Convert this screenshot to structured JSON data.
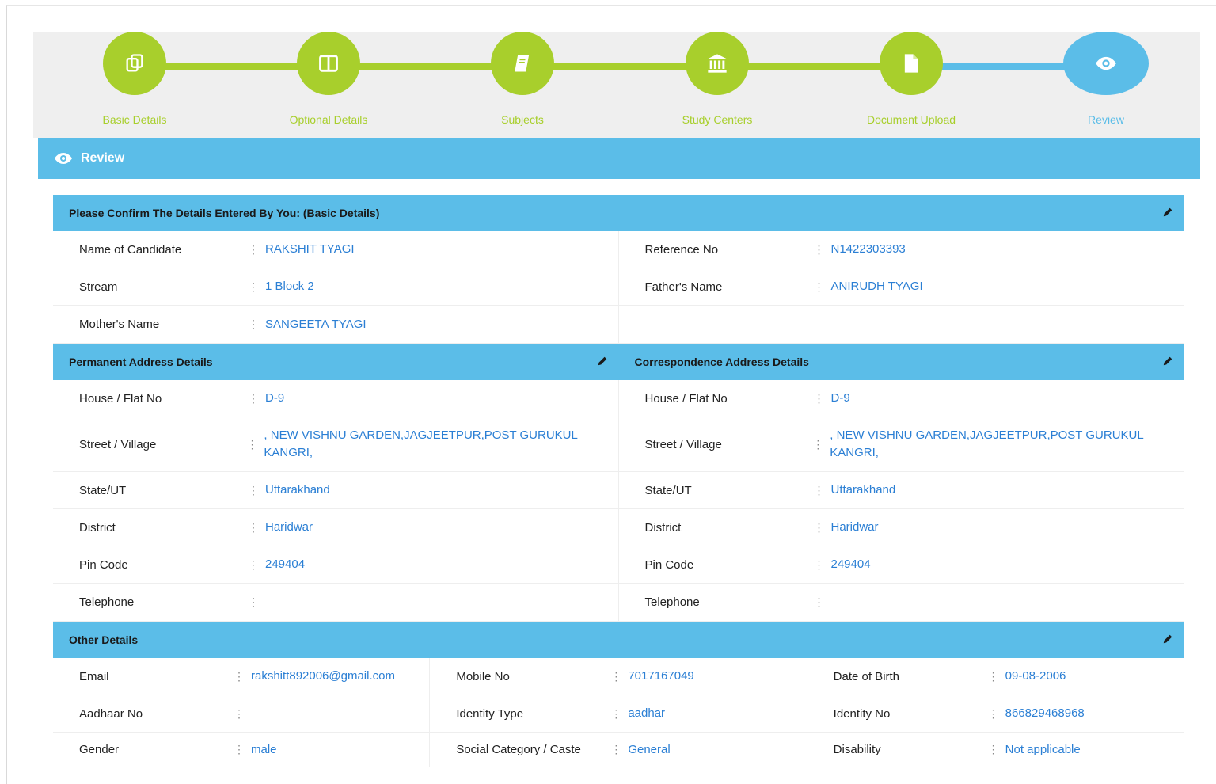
{
  "steps": [
    {
      "label": "Basic Details",
      "icon": "copy-icon"
    },
    {
      "label": "Optional Details",
      "icon": "columns-icon"
    },
    {
      "label": "Subjects",
      "icon": "book-icon"
    },
    {
      "label": "Study Centers",
      "icon": "bank-icon"
    },
    {
      "label": "Document Upload",
      "icon": "file-icon"
    },
    {
      "label": "Review",
      "icon": "eye-icon",
      "active": true
    }
  ],
  "review": {
    "title": "Review"
  },
  "basic": {
    "title": "Please Confirm The Details Entered By You: (Basic Details)",
    "name_label": "Name of Candidate",
    "name": "RAKSHIT TYAGI",
    "ref_label": "Reference No",
    "ref": "N1422303393",
    "stream_label": "Stream",
    "stream": "1 Block 2",
    "father_label": "Father's Name",
    "father": "ANIRUDH TYAGI",
    "mother_label": "Mother's Name",
    "mother": "SANGEETA TYAGI"
  },
  "permanent": {
    "title": "Permanent Address Details",
    "house_label": "House / Flat No",
    "house": "D-9",
    "street_label": "Street / Village",
    "street": ", NEW VISHNU GARDEN,JAGJEETPUR,POST GURUKUL KANGRI,",
    "state_label": "State/UT",
    "state": "Uttarakhand",
    "district_label": "District",
    "district": "Haridwar",
    "pin_label": "Pin Code",
    "pin": "249404",
    "tel_label": "Telephone",
    "tel": ""
  },
  "correspondence": {
    "title": "Correspondence Address Details",
    "house_label": "House / Flat No",
    "house": "D-9",
    "street_label": "Street / Village",
    "street": ", NEW VISHNU GARDEN,JAGJEETPUR,POST GURUKUL KANGRI,",
    "state_label": "State/UT",
    "state": "Uttarakhand",
    "district_label": "District",
    "district": "Haridwar",
    "pin_label": "Pin Code",
    "pin": "249404",
    "tel_label": "Telephone",
    "tel": ""
  },
  "other": {
    "title": "Other Details",
    "email_label": "Email",
    "email": "rakshitt892006@gmail.com",
    "mobile_label": "Mobile No",
    "mobile": "7017167049",
    "dob_label": "Date of Birth",
    "dob": "09-08-2006",
    "aadhaar_label": "Aadhaar No",
    "aadhaar": "",
    "idtype_label": "Identity Type",
    "idtype": "aadhar",
    "idno_label": "Identity No",
    "idno": "866829468968",
    "gender_label": "Gender",
    "gender": "male",
    "caste_label": "Social Category / Caste",
    "caste": "General",
    "disability_label": "Disability",
    "disability": "Not applicable"
  },
  "colors": {
    "accent_green": "#a8cf2c",
    "accent_blue": "#5bbde8",
    "value_blue": "#2b7fd4"
  }
}
